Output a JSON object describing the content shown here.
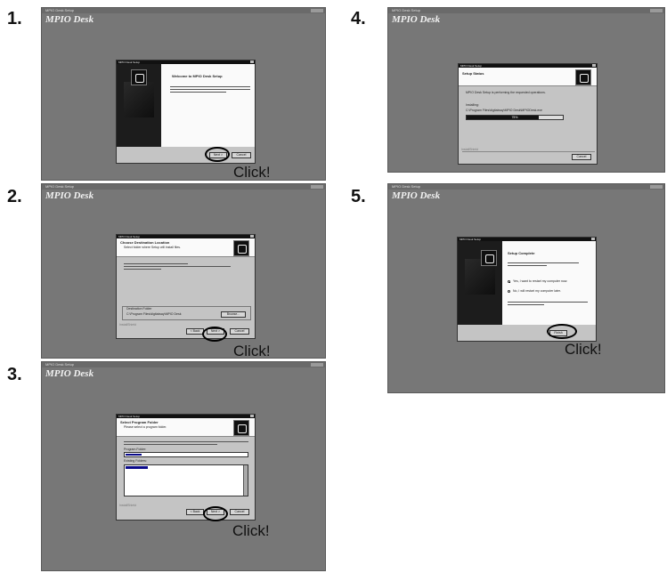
{
  "app_title": "MPIO Desk",
  "titlebar_text": "MPIO Desk Setup",
  "click_label": "Click!",
  "steps": [
    {
      "number": "1.",
      "dialog_title": "MPIO Desk Setup",
      "heading": "Welcome to MPIO Desk Setup",
      "body": "This program will install MPIO Desk on your computer. It is strongly recommended that you exit all Windows programs before running this Setup program.",
      "buttons": [
        "Next >",
        "Cancel"
      ]
    },
    {
      "number": "2.",
      "dialog_title": "MPIO Desk Setup",
      "header_title": "Choose Destination Location",
      "header_sub": "Select folder where Setup will install files.",
      "body1": "Setup will install MPIO Desk in the following folder.",
      "body2": "To install to this folder, click Next. To install to a different folder, click Browse and select another folder.",
      "group_label": "Destination Folder",
      "path": "C:\\Program Files\\digitalway\\MPIO Desk",
      "browse": "Browse...",
      "footer": "InstallShield",
      "buttons": [
        "< Back",
        "Next >",
        "Cancel"
      ]
    },
    {
      "number": "3.",
      "dialog_title": "MPIO Desk Setup",
      "header_title": "Select Program Folder",
      "header_sub": "Please select a program folder.",
      "body": "Setup will add program icons to the Program Folder listed below. You may type a new folder name, or select one from the existing folders list. Click Next to continue.",
      "program_folder_label": "Program Folder:",
      "existing_folders_label": "Existing Folders:",
      "footer": "InstallShield",
      "buttons": [
        "< Back",
        "Next >",
        "Cancel"
      ]
    },
    {
      "number": "4.",
      "dialog_title": "MPIO Desk Setup",
      "header_title": "Setup Status",
      "status": "MPIO Desk Setup is performing the requested operations.",
      "installing": "Installing:",
      "file": "C:\\Program Files\\digitalway\\MPIO Desk\\MPIODesk.exe",
      "progress": 0.75,
      "progress_label": "75%",
      "footer": "InstallShield",
      "buttons": [
        "Cancel"
      ]
    },
    {
      "number": "5.",
      "dialog_title": "MPIO Desk Setup",
      "heading": "Setup Complete",
      "body": "Before you can use the program, you must restart your computer.",
      "option_yes": "Yes, I want to restart my computer now.",
      "option_no": "No, I will restart my computer later.",
      "body2": "Remove any disks from their drives, and then click Finish to complete setup.",
      "buttons": [
        "Finish"
      ]
    }
  ]
}
